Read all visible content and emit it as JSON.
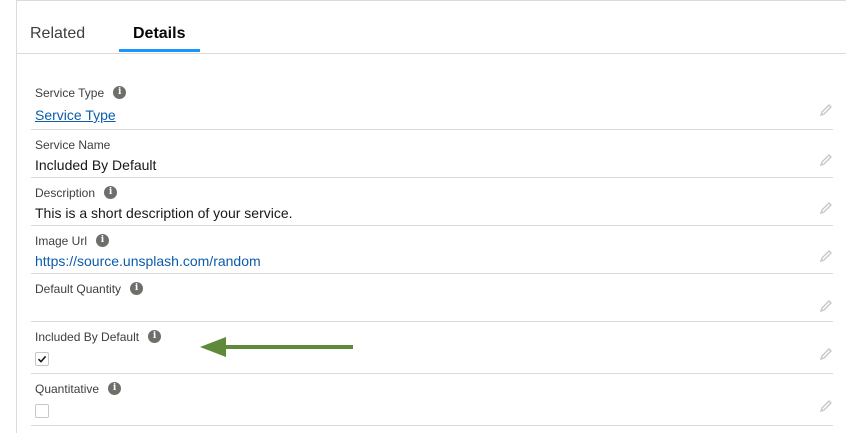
{
  "tabs": [
    {
      "label": "Related",
      "active": false
    },
    {
      "label": "Details",
      "active": true
    }
  ],
  "fields": {
    "service_type": {
      "label": "Service Type",
      "value": "Service Type",
      "has_info": true
    },
    "service_name": {
      "label": "Service Name",
      "value": "Included By Default",
      "has_info": false
    },
    "description": {
      "label": "Description",
      "value": "This is a short description of your service.",
      "has_info": true
    },
    "image_url": {
      "label": "Image Url",
      "value": "https://source.unsplash.com/random",
      "has_info": true
    },
    "default_quantity": {
      "label": "Default Quantity",
      "value": "",
      "has_info": true
    },
    "included_by_default": {
      "label": "Included By Default",
      "checked": true,
      "has_info": true
    },
    "quantitative": {
      "label": "Quantitative",
      "checked": false,
      "has_info": true
    }
  },
  "icons": {
    "info": "info-icon",
    "edit": "pencil-icon",
    "check": "checkmark-icon",
    "annotation": "arrow-left-icon"
  },
  "colors": {
    "tab_active_underline": "#1b96ff",
    "link": "#0b5cab",
    "annotation_arrow": "#5e8a3a",
    "info_icon": "#706e6b"
  },
  "info_glyph": "i"
}
